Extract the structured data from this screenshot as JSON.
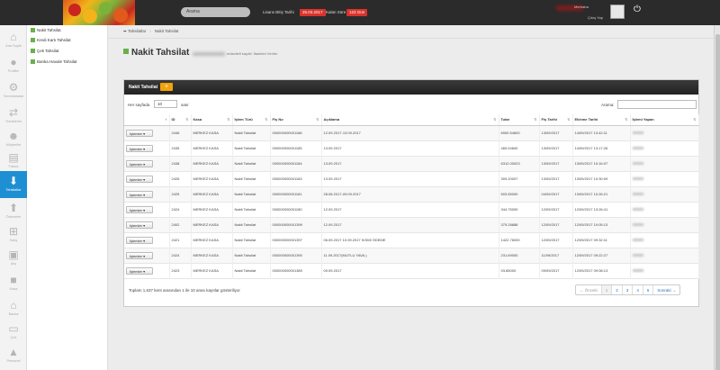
{
  "topbar": {
    "search_placeholder": "Arama",
    "license_label": "Lisans Bitiş Tarihi",
    "license_date": "25.03.2017",
    "remaining_label": "Kalan Süre",
    "remaining_days": "123 Gün",
    "user_name": "Merhaba",
    "user_role": "Çıkış Yap",
    "power_icon": "power-icon"
  },
  "leftnav": [
    {
      "label": "Ana Sayfa",
      "icon": "home-icon"
    },
    {
      "label": "Profilim",
      "icon": "user-icon"
    },
    {
      "label": "Tanımlamalar",
      "icon": "gears-icon"
    },
    {
      "label": "Transferler",
      "icon": "transfer-icon"
    },
    {
      "label": "Müşteriler",
      "icon": "users-icon"
    },
    {
      "label": "Fatura",
      "icon": "invoice-icon"
    },
    {
      "label": "Tahsilatlar",
      "icon": "download-icon",
      "active": true
    },
    {
      "label": "Ödemeler",
      "icon": "upload-icon"
    },
    {
      "label": "Satış",
      "icon": "cart-icon"
    },
    {
      "label": "Alış",
      "icon": "basket-icon"
    },
    {
      "label": "Kasa",
      "icon": "lock-icon"
    },
    {
      "label": "Banka",
      "icon": "bank-icon"
    },
    {
      "label": "Çek",
      "icon": "check-icon"
    },
    {
      "label": "Personel",
      "icon": "staff-icon"
    }
  ],
  "submenu": [
    {
      "label": "Nakit Tahsilat"
    },
    {
      "label": "Kredi Kartı Tahsilat"
    },
    {
      "label": "Çek Tahsilat"
    },
    {
      "label": "Banka Havale Tahsilat"
    }
  ],
  "breadcrumb": [
    "Tahsilatlar",
    "Nakit Tahsilat"
  ],
  "page": {
    "title": "Nakit Tahsilat",
    "subtitle": "mükellefi kayıtlı! İfadeleri Veriler"
  },
  "panel": {
    "title": "Nakit Tahsilat",
    "add_label": "+",
    "length_prefix": "Her sayfada",
    "length_value": "10",
    "length_suffix": "satır",
    "search_label": "Arama:",
    "columns": [
      "",
      "ID",
      "Kasa",
      "İşlem Türü",
      "Fiş No",
      "Açıklama",
      "Tutar",
      "Fiş Tarihi",
      "Ekleme Tarihi",
      "İşlemi Yapan"
    ],
    "action_label": "İşlemler",
    "rows": [
      {
        "id": "2446",
        "kasa": "MERKEZ KASA",
        "tur": "Nakit Tahsilat",
        "fis": "000000000001186",
        "aciklama": "12.09.2017-13.09.2017",
        "tutar": "6900.54600",
        "fis_tarihi": "13/09/2017",
        "ekleme": "14/09/2017 13:42:11"
      },
      {
        "id": "2435",
        "kasa": "MERKEZ KASA",
        "tur": "Nakit Tahsilat",
        "fis": "000000000001185",
        "aciklama": "13.09.2017",
        "tutar": "460.04600",
        "fis_tarihi": "13/09/2017",
        "ekleme": "14/09/2017 13:17:26"
      },
      {
        "id": "2438",
        "kasa": "MERKEZ KASA",
        "tur": "Nakit Tahsilat",
        "fis": "000000000001184",
        "aciklama": "13.09.2017",
        "tutar": "6312.00023",
        "fis_tarihi": "13/09/2017",
        "ekleme": "13/09/2017 10:16:07"
      },
      {
        "id": "2426",
        "kasa": "MERKEZ KASA",
        "tur": "Nakit Tahsilat",
        "fis": "000000000001183",
        "aciklama": "13.09.2017",
        "tutar": "309.20007",
        "fis_tarihi": "13/09/2017",
        "ekleme": "13/09/2017 10:30:09"
      },
      {
        "id": "2425",
        "kasa": "MERKEZ KASA",
        "tur": "Nakit Tahsilat",
        "fis": "000000000001181",
        "aciklama": "28.08.2017-09.09.2017",
        "tutar": "503.55000",
        "fis_tarihi": "04/09/2017",
        "ekleme": "13/09/2017 10:26:21"
      },
      {
        "id": "2424",
        "kasa": "MERKEZ KASA",
        "tur": "Nakit Tahsilat",
        "fis": "000000000001180",
        "aciklama": "12.09.2017",
        "tutar": "344.75000",
        "fis_tarihi": "12/09/2017",
        "ekleme": "12/09/2017 13:26:41"
      },
      {
        "id": "2402",
        "kasa": "MERKEZ KASA",
        "tur": "Nakit Tahsilat",
        "fis": "000000000001399",
        "aciklama": "12.09.2017",
        "tutar": "375.28888",
        "fis_tarihi": "12/09/2017",
        "ekleme": "12/09/2017 10:05:13"
      },
      {
        "id": "2421",
        "kasa": "MERKEZ KASA",
        "tur": "Nakit Tahsilat",
        "fis": "000000000001397",
        "aciklama": "06.09.2017 10.09.2017 KISMİ ÖDEME",
        "tutar": "1422.76000",
        "fis_tarihi": "12/09/2017",
        "ekleme": "12/09/2017 09:32:11"
      },
      {
        "id": "2424",
        "kasa": "MERKEZ KASA",
        "tur": "Nakit Tahsilat",
        "fis": "000000000001390",
        "aciklama": "11.09.2017(MUTLU YAVA.)",
        "tutar": "231.69000",
        "fis_tarihi": "11/09/2017",
        "ekleme": "12/09/2017 09:22:27"
      },
      {
        "id": "2423",
        "kasa": "MERKEZ KASA",
        "tur": "Nakit Tahsilat",
        "fis": "000000000001389",
        "aciklama": "09.09.2017",
        "tutar": "93.85000",
        "fis_tarihi": "09/09/2017",
        "ekleme": "12/09/2017 09:08:13"
      }
    ],
    "info": "Toplam 1,637 kent arasından 1 ile 10 arası kayıtlar gösteriliyor",
    "pager": [
      "← Önceki",
      "1",
      "2",
      "3",
      "4",
      "5",
      "Sonraki →"
    ]
  }
}
